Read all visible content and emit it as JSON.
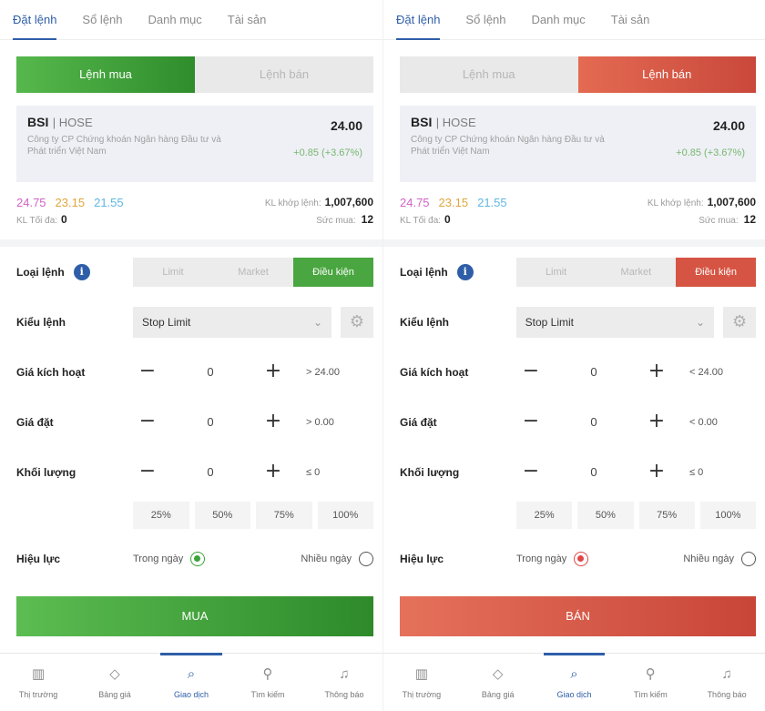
{
  "tabs": [
    "Đặt lệnh",
    "Sổ lệnh",
    "Danh mục",
    "Tài sản"
  ],
  "side_labels": {
    "buy": "Lệnh mua",
    "sell": "Lệnh bán"
  },
  "stock": {
    "symbol": "BSI",
    "exchange": "| HOSE",
    "name": "Công ty CP Chứng khoán Ngân hàng Đầu tư và Phát triển Việt Nam",
    "price": "24.00",
    "change": "+0.85 (+3.67%)"
  },
  "quote": {
    "ceiling": "24.75",
    "reference": "23.15",
    "floor": "21.55",
    "matched_label": "KL khớp lệnh:",
    "matched_value": "1,007,600",
    "max_label": "KL Tối đa:",
    "max_value": "0",
    "power_label": "Sức mua:",
    "power_value": "12"
  },
  "labels": {
    "order_type": "Loại lệnh",
    "order_kind": "Kiểu lệnh",
    "trigger_price": "Giá kích hoạt",
    "price": "Giá đặt",
    "volume": "Khối lượng",
    "validity": "Hiệu lực"
  },
  "order_types": [
    "Limit",
    "Market",
    "Điều kiện"
  ],
  "order_kind_value": "Stop Limit",
  "percents": [
    "25%",
    "50%",
    "75%",
    "100%"
  ],
  "validity_options": {
    "day": "Trong ngày",
    "multi": "Nhiều ngày"
  },
  "panels": {
    "buy": {
      "trigger_value": "0",
      "trigger_cond": "> 24.00",
      "price_value": "0",
      "price_cond": "> 0.00",
      "volume_value": "0",
      "volume_cond": "≤ 0",
      "submit": "MUA"
    },
    "sell": {
      "trigger_value": "0",
      "trigger_cond": "< 24.00",
      "price_value": "0",
      "price_cond": "< 0.00",
      "volume_value": "0",
      "volume_cond": "≤ 0",
      "submit": "BÁN"
    }
  },
  "bottom_nav": [
    "Thị trường",
    "Bảng giá",
    "Giao dịch",
    "Tìm kiếm",
    "Thông báo"
  ],
  "icons": [
    "chart-icon",
    "tag-icon",
    "trade-icon",
    "search-icon",
    "bell-icon"
  ],
  "colors": {
    "accent": "#2f5ea8",
    "buy": "#3aa43a",
    "sell": "#d65443"
  }
}
